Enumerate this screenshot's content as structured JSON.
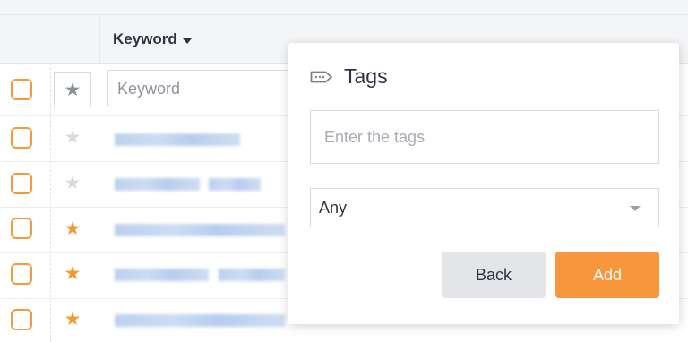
{
  "table": {
    "column_header": "Keyword",
    "filter_placeholder": "Keyword",
    "rows": [
      {
        "starred": false
      },
      {
        "starred": false
      },
      {
        "starred": true
      },
      {
        "starred": true
      },
      {
        "starred": true
      }
    ]
  },
  "popup": {
    "title": "Tags",
    "tags_placeholder": "Enter the tags",
    "match_select_value": "Any",
    "back_label": "Back",
    "add_label": "Add"
  },
  "icons": {
    "header_star": "star-icon",
    "row_star": "star-icon",
    "tag": "tag-icon",
    "sort_caret": "chevron-down-icon"
  },
  "colors": {
    "accent": "#f7963a",
    "checkbox_border": "#f29a3c",
    "star_active": "#f39a2e",
    "star_inactive": "#d7dadf"
  }
}
